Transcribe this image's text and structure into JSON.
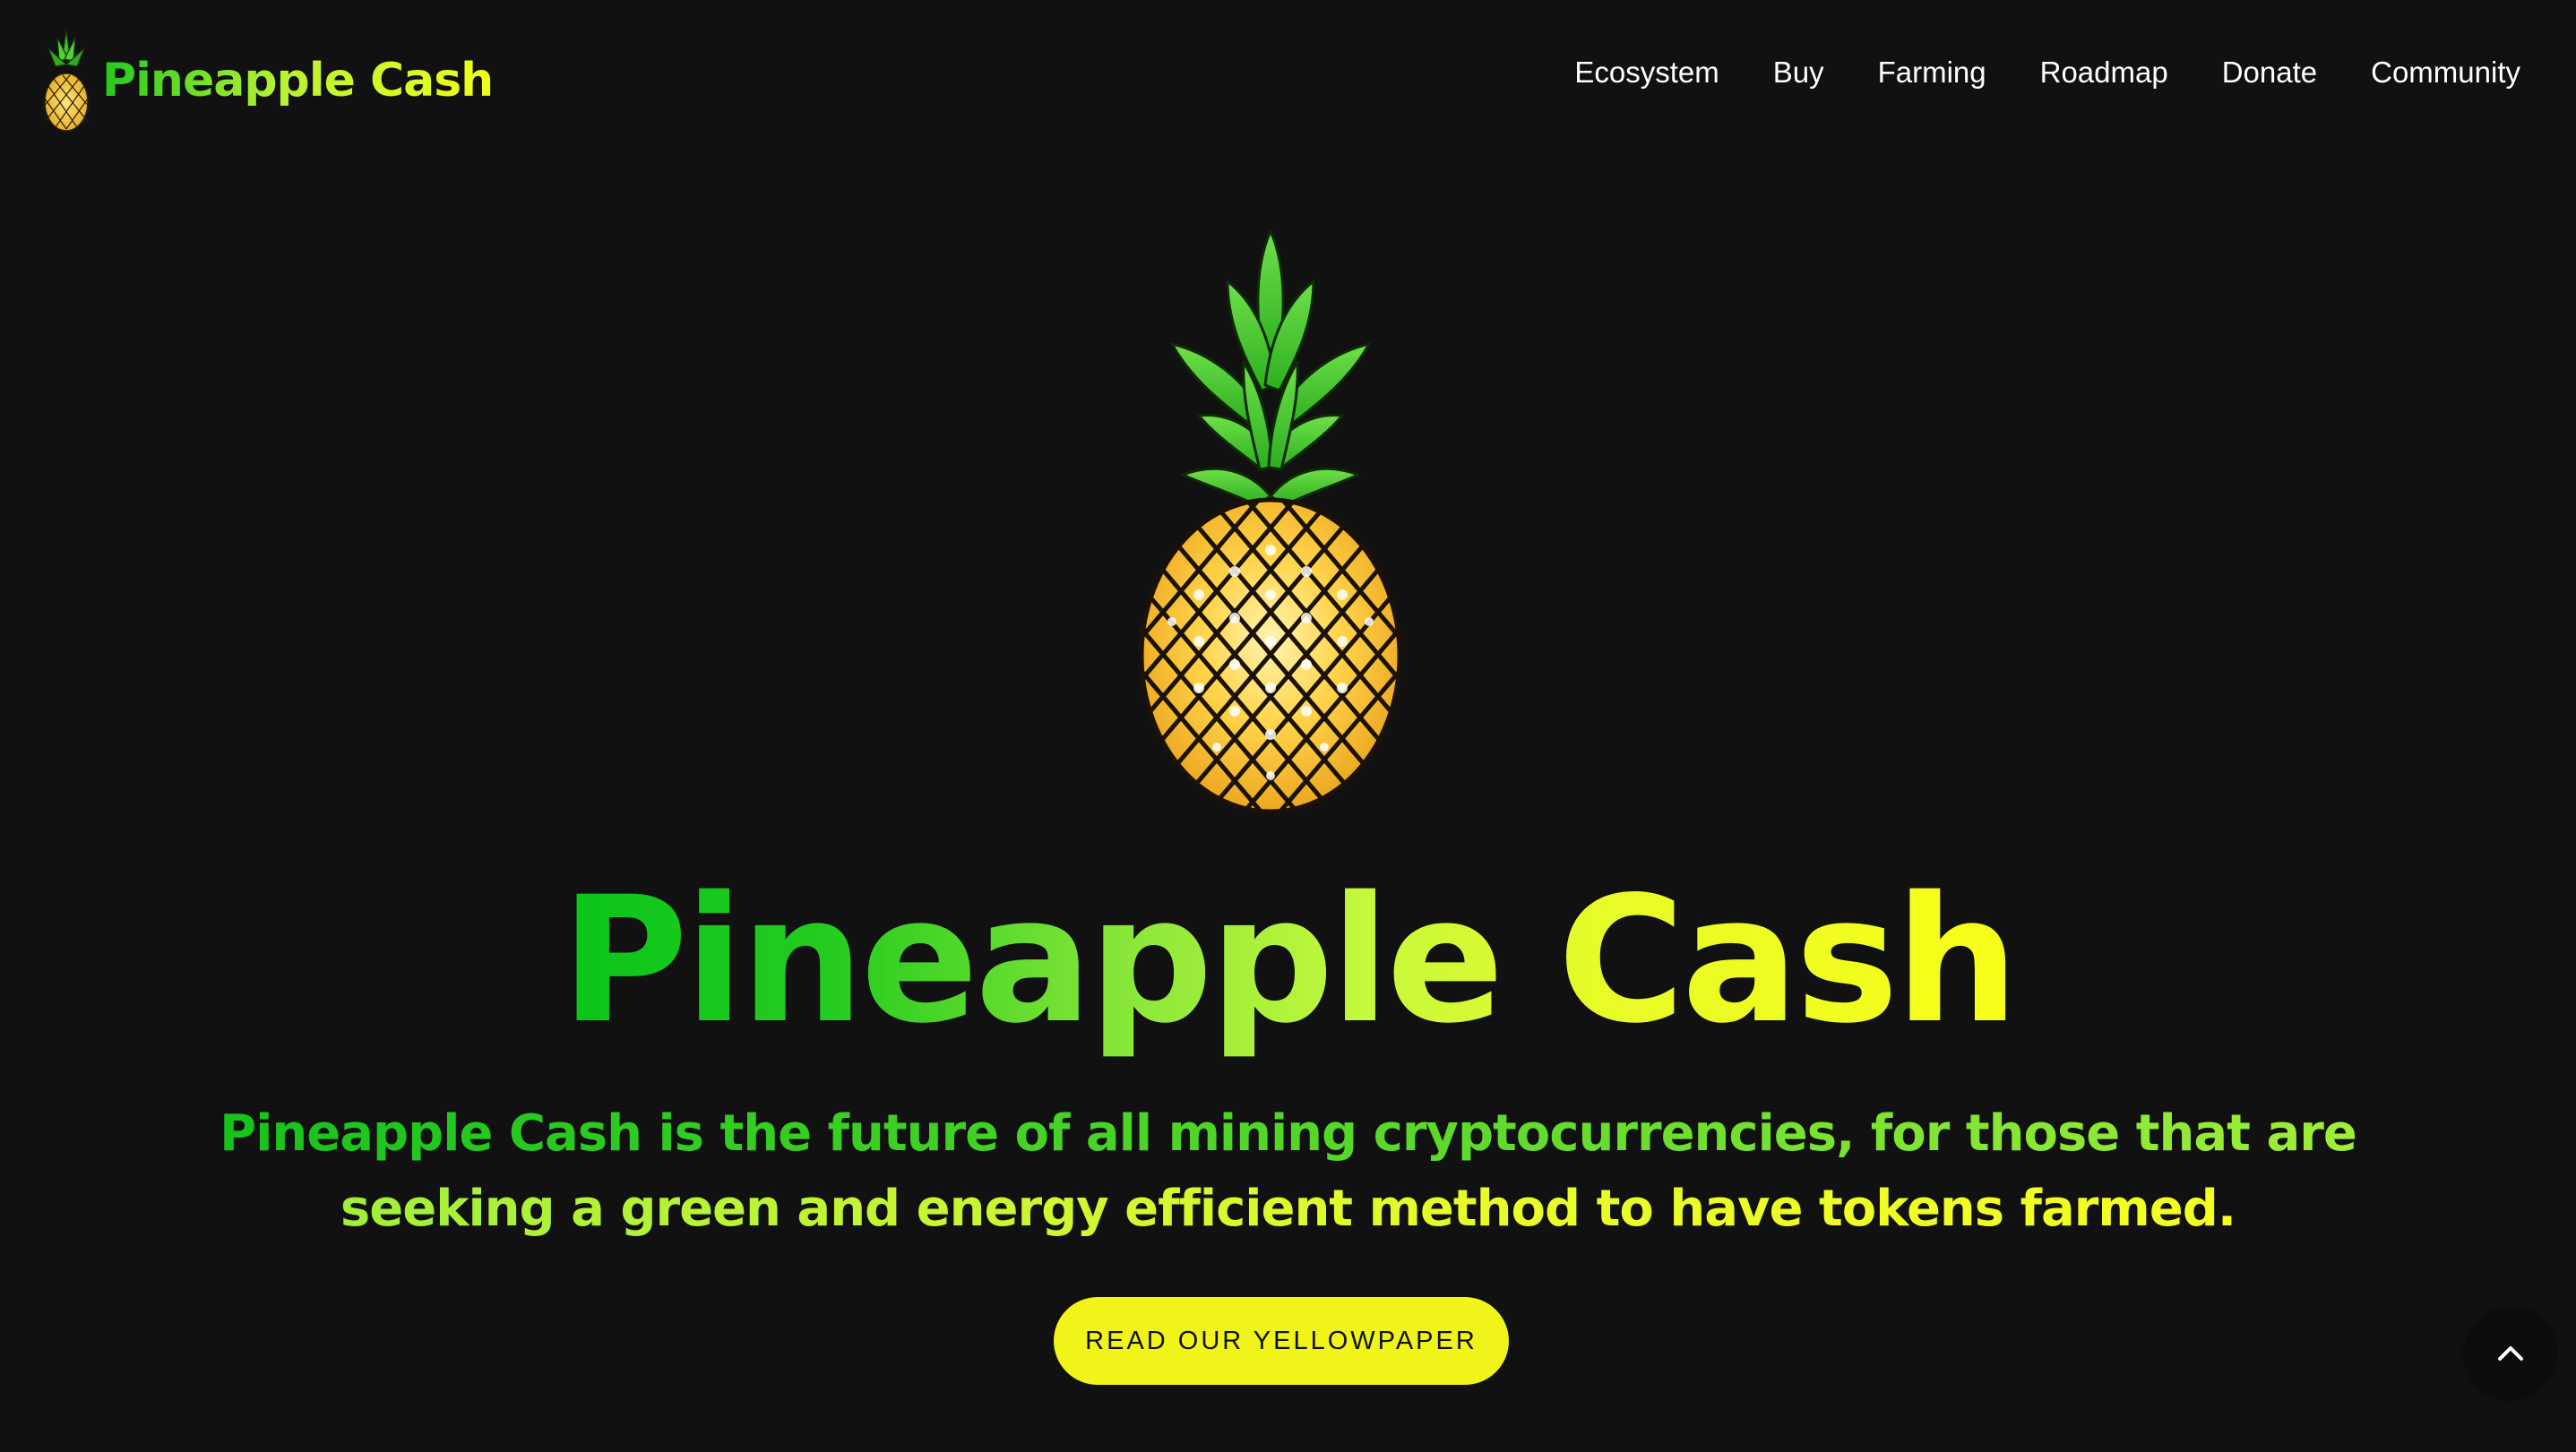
{
  "header": {
    "brand_name": "Pineapple Cash",
    "brand_logo_icon": "pineapple-icon",
    "nav": [
      {
        "label": "Ecosystem"
      },
      {
        "label": "Buy"
      },
      {
        "label": "Farming"
      },
      {
        "label": "Roadmap"
      },
      {
        "label": "Donate"
      },
      {
        "label": "Community"
      }
    ]
  },
  "hero": {
    "image_icon": "pineapple-illustration",
    "title": "Pineapple Cash",
    "description": "Pineapple Cash is the future of all mining cryptocurrencies, for those that are seeking a green and energy efficient method to have tokens farmed.",
    "cta_label": "READ OUR YELLOWPAPER"
  },
  "scroll_top_icon": "chevron-up-icon",
  "colors": {
    "background": "#111111",
    "gradient_green": "#0bc51a",
    "gradient_yellow": "#f6ff18",
    "button_yellow": "#f0f418",
    "nav_text": "#ffffff"
  }
}
